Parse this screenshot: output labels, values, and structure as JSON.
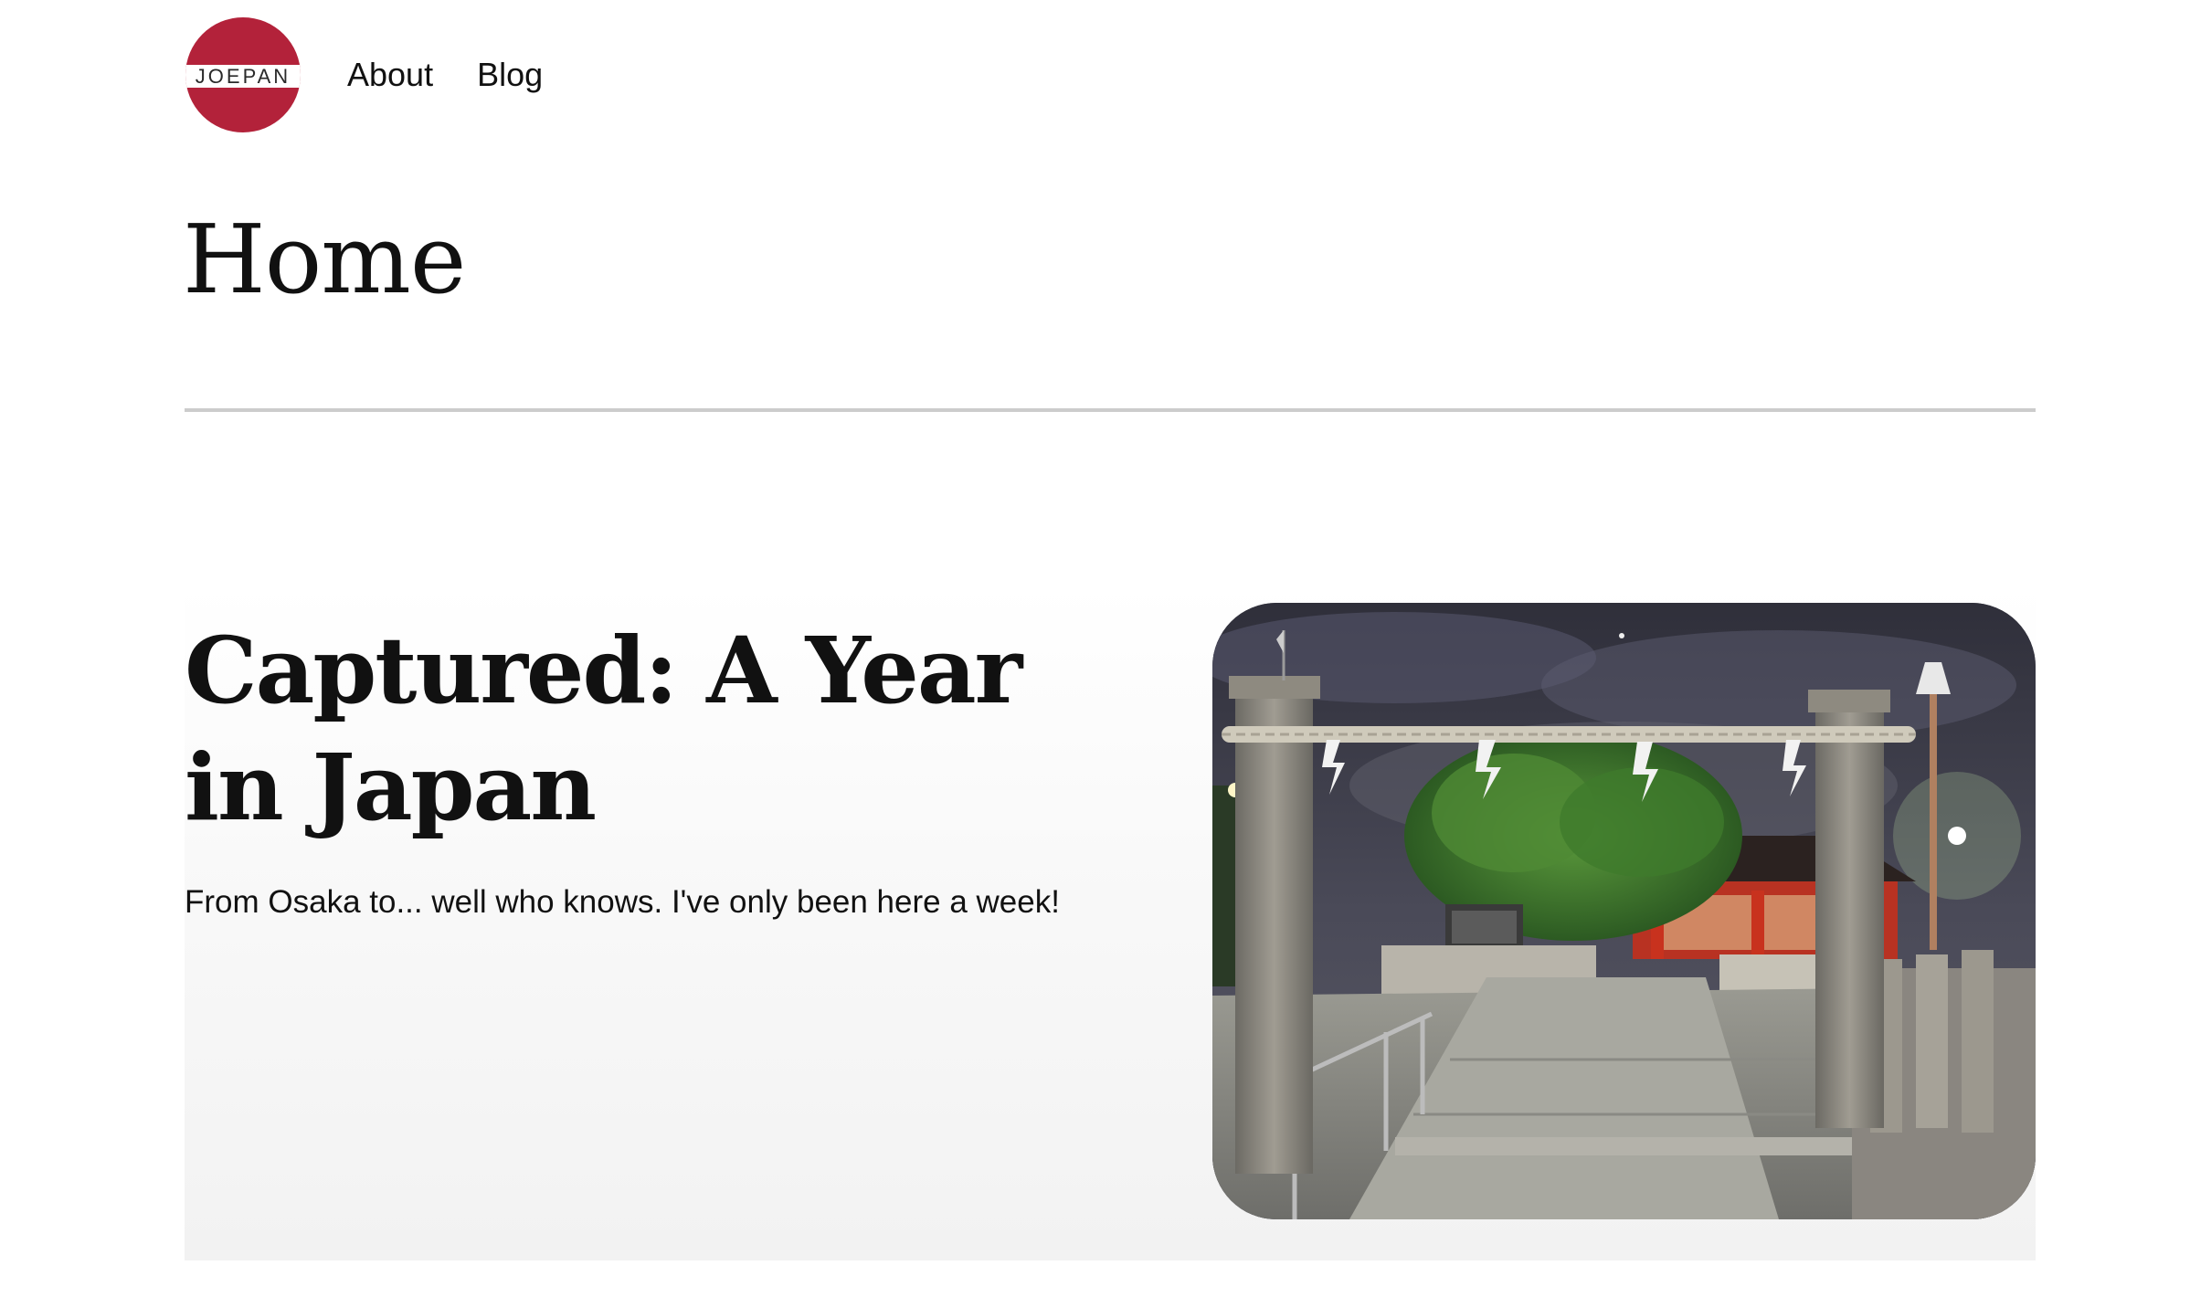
{
  "header": {
    "logo_text": "JOEPAN",
    "nav": [
      {
        "label": "About"
      },
      {
        "label": "Blog"
      }
    ]
  },
  "page": {
    "title": "Home"
  },
  "featured_post": {
    "title": "Captured: A Year in Japan",
    "excerpt": "From Osaka to... well who knows. I've only been here a week!",
    "image_icon": "shrine-torii-photo"
  },
  "colors": {
    "logo_red": "#b3223a",
    "divider": "#cccccc"
  }
}
